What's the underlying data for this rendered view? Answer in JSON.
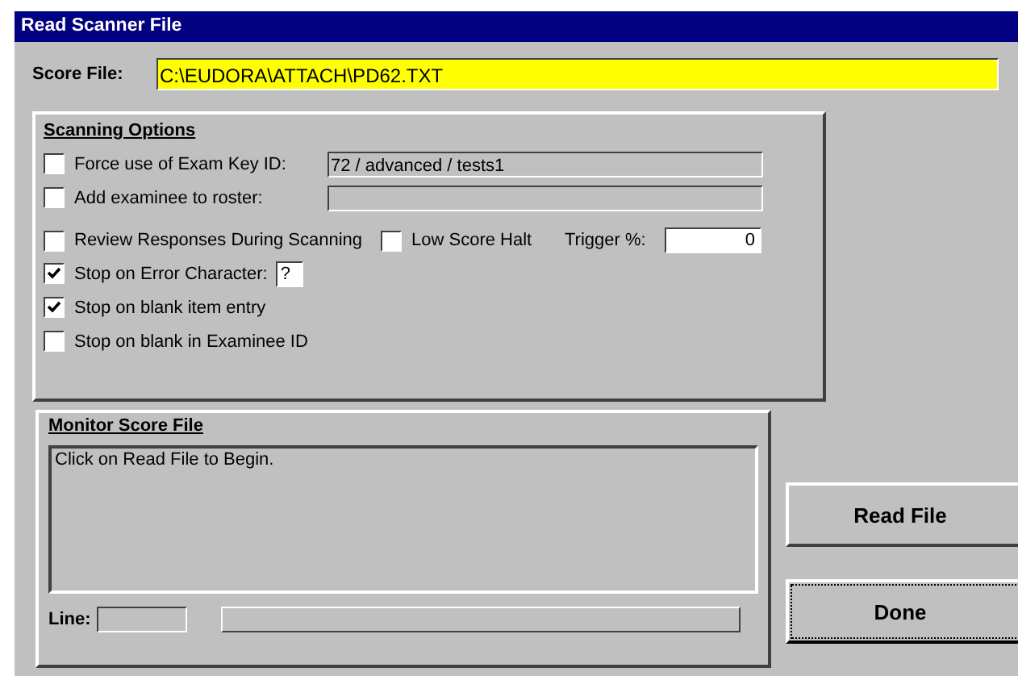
{
  "window": {
    "title": "Read Scanner File"
  },
  "score_file": {
    "label": "Score File:",
    "value": "C:\\EUDORA\\ATTACH\\PD62.TXT"
  },
  "scanning_options": {
    "title": "Scanning Options",
    "exam_key": {
      "label": "Force use of Exam Key ID:",
      "checked": false,
      "value": "72 / advanced / tests1"
    },
    "roster": {
      "label": "Add examinee to roster:",
      "checked": false
    },
    "review": {
      "label": "Review Responses During Scanning",
      "checked": false
    },
    "low_score": {
      "label": "Low Score Halt",
      "checked": false
    },
    "trigger": {
      "label": "Trigger %:",
      "value": "0"
    },
    "error_char": {
      "label": "Stop on Error Character:",
      "checked": true,
      "value": "?"
    },
    "blank_item": {
      "label": "Stop on blank item entry",
      "checked": true
    },
    "blank_id": {
      "label": "Stop on blank in Examinee ID",
      "checked": false
    }
  },
  "monitor": {
    "title": "Monitor Score File",
    "log": "Click on Read File to Begin.",
    "line_label": "Line:",
    "progress": {
      "level": 0
    }
  },
  "buttons": [
    {
      "label": "Read File",
      "focused": false
    },
    {
      "label": "Done",
      "focused": true
    }
  ]
}
